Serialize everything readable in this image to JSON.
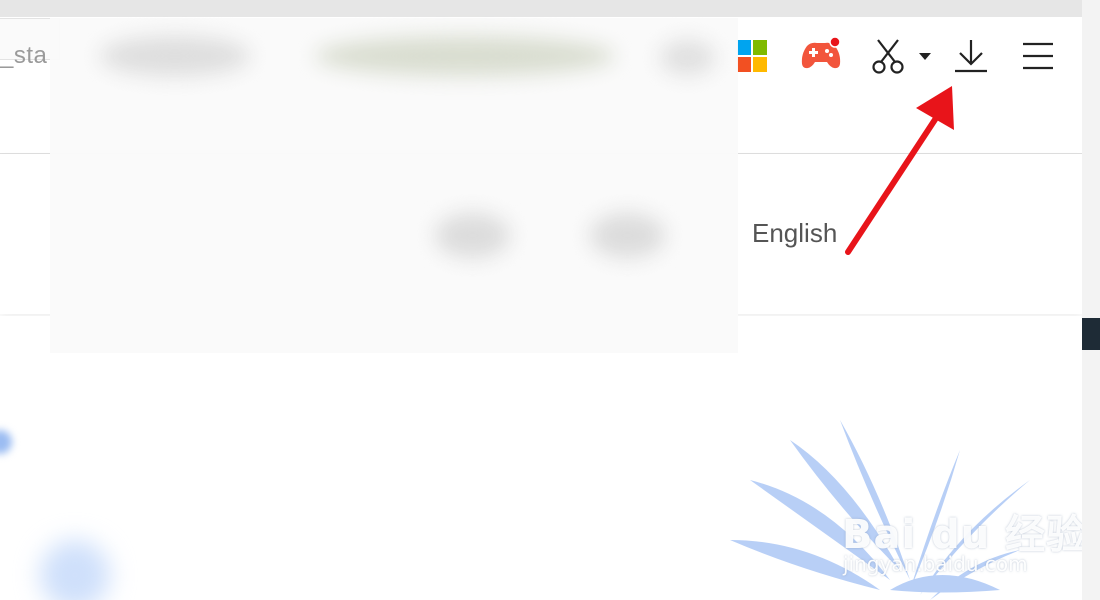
{
  "browser": {
    "address_partial": "_sta",
    "toolbar_icons": [
      "apps-grid-icon",
      "game-controller-icon",
      "scissors-icon",
      "dropdown-caret-icon",
      "download-icon",
      "menu-icon"
    ]
  },
  "page": {
    "language_link": "English"
  },
  "watermark": {
    "brand": "Bai du 经验",
    "site": "jingyan.baidu.com"
  },
  "colors": {
    "arrow": "#e8141a",
    "game_icon": "#f2553c",
    "badge": "#e8141a",
    "apps_red": "#f25022",
    "apps_green": "#7fba00",
    "apps_blue": "#00a4ef",
    "apps_yellow": "#ffb900"
  }
}
